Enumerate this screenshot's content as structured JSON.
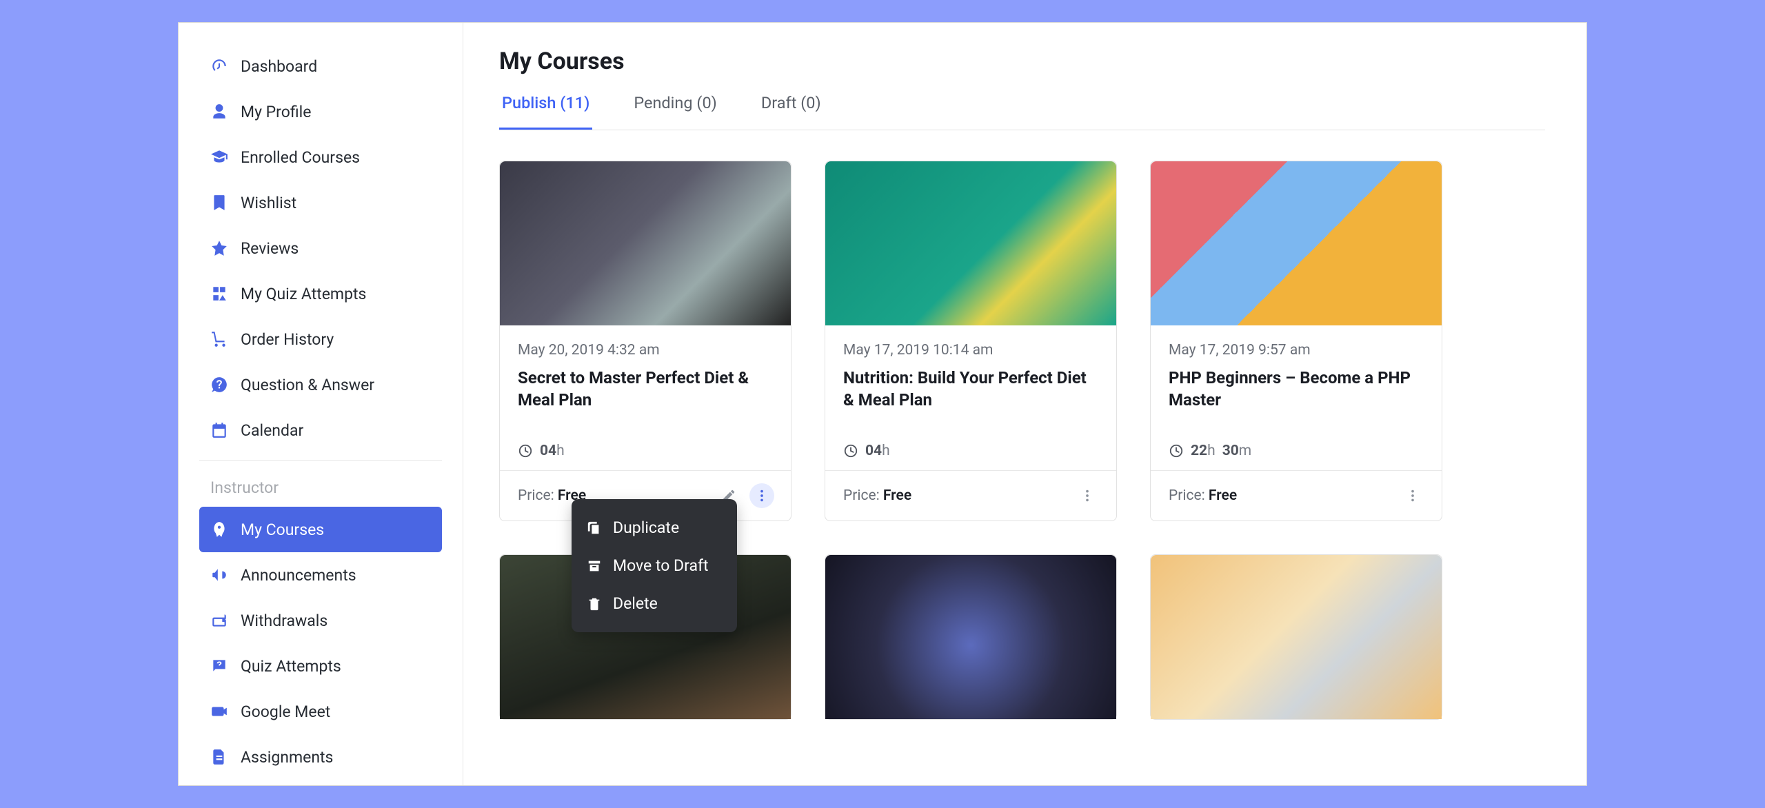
{
  "sidebar": {
    "student_items": [
      {
        "label": "Dashboard",
        "icon": "gauge"
      },
      {
        "label": "My Profile",
        "icon": "user"
      },
      {
        "label": "Enrolled Courses",
        "icon": "graduation"
      },
      {
        "label": "Wishlist",
        "icon": "bookmark"
      },
      {
        "label": "Reviews",
        "icon": "star"
      },
      {
        "label": "My Quiz Attempts",
        "icon": "quiz"
      },
      {
        "label": "Order History",
        "icon": "cart"
      },
      {
        "label": "Question & Answer",
        "icon": "qa"
      },
      {
        "label": "Calendar",
        "icon": "calendar"
      }
    ],
    "instructor_label": "Instructor",
    "instructor_items": [
      {
        "label": "My Courses",
        "icon": "rocket",
        "active": true
      },
      {
        "label": "Announcements",
        "icon": "megaphone"
      },
      {
        "label": "Withdrawals",
        "icon": "wallet"
      },
      {
        "label": "Quiz Attempts",
        "icon": "question"
      },
      {
        "label": "Google Meet",
        "icon": "video"
      },
      {
        "label": "Assignments",
        "icon": "doc"
      }
    ]
  },
  "page": {
    "title": "My Courses",
    "tabs": [
      {
        "label": "Publish (11)",
        "active": true
      },
      {
        "label": "Pending (0)"
      },
      {
        "label": "Draft (0)"
      }
    ]
  },
  "courses": [
    {
      "date": "May 20, 2019 4:32 am",
      "title": "Secret to Master Perfect Diet & Meal Plan",
      "duration": [
        {
          "v": "04",
          "u": "h"
        }
      ],
      "price_label": "Price:",
      "price": "Free",
      "thumb": "tn1",
      "menuOpen": true,
      "showEdit": true
    },
    {
      "date": "May 17, 2019 10:14 am",
      "title": "Nutrition: Build Your Perfect Diet & Meal Plan",
      "duration": [
        {
          "v": "04",
          "u": "h"
        }
      ],
      "price_label": "Price:",
      "price": "Free",
      "thumb": "tn2"
    },
    {
      "date": "May 17, 2019 9:57 am",
      "title": "PHP Beginners – Become a PHP Master",
      "duration": [
        {
          "v": "22",
          "u": "h"
        },
        {
          "v": "30",
          "u": "m"
        }
      ],
      "price_label": "Price:",
      "price": "Free",
      "thumb": "tn3"
    },
    {
      "date": "",
      "title": "",
      "duration": [],
      "price_label": "",
      "price": "",
      "thumb": "tn4",
      "stub": true
    },
    {
      "date": "",
      "title": "",
      "duration": [],
      "price_label": "",
      "price": "",
      "thumb": "tn5",
      "stub": true
    },
    {
      "date": "",
      "title": "",
      "duration": [],
      "price_label": "",
      "price": "",
      "thumb": "tn6",
      "stub": true
    }
  ],
  "menu": {
    "items": [
      {
        "label": "Duplicate",
        "icon": "copy"
      },
      {
        "label": "Move to Draft",
        "icon": "archive"
      },
      {
        "label": "Delete",
        "icon": "trash"
      }
    ]
  }
}
